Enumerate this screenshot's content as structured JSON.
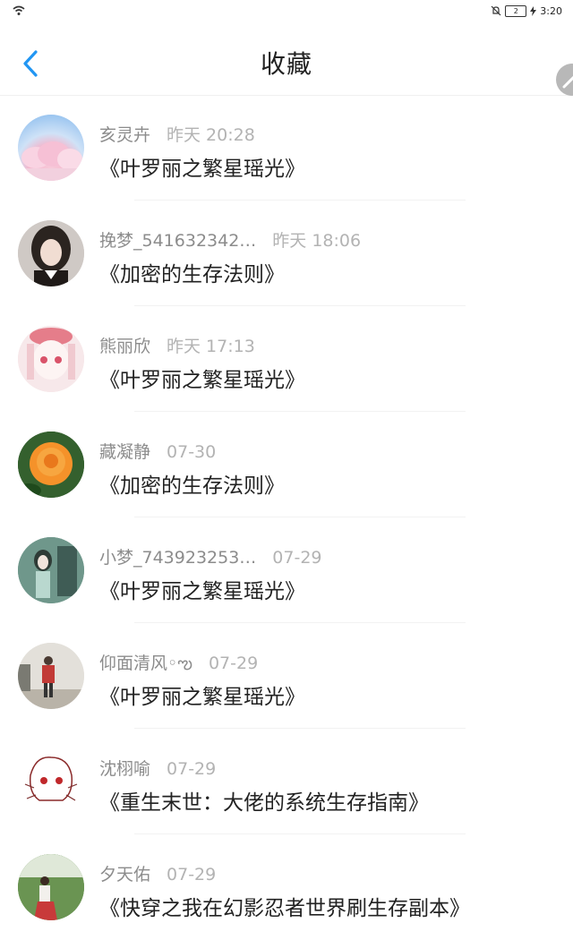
{
  "status": {
    "time": "3:20",
    "battery": "2"
  },
  "header": {
    "title": "收藏"
  },
  "colors": {
    "accent": "#2196f3",
    "name_text": "#8c8c8c",
    "time_text": "#b3b3b3"
  },
  "favorites": [
    {
      "user": "亥灵卉",
      "time": "昨天 20:28",
      "book": "《叶罗丽之繁星瑶光》",
      "avatar": "pink-snow-trees"
    },
    {
      "user": "挽梦_541632342…",
      "time": "昨天 18:06",
      "book": "《加密的生存法则》",
      "avatar": "girl-photo"
    },
    {
      "user": "熊丽欣",
      "time": "昨天 17:13",
      "book": "《叶罗丽之繁星瑶光》",
      "avatar": "anime-girl-pink"
    },
    {
      "user": "藏凝静",
      "time": "07-30",
      "book": "《加密的生存法则》",
      "avatar": "orange-rose"
    },
    {
      "user": "小梦_743923253…",
      "time": "07-29",
      "book": "《叶罗丽之繁星瑶光》",
      "avatar": "anime-girl-green"
    },
    {
      "user": "仰面清风◦ఌ",
      "time": "07-29",
      "book": "《叶罗丽之繁星瑶光》",
      "avatar": "person-red-outdoor"
    },
    {
      "user": "沈栩喻",
      "time": "07-29",
      "book": "《重生末世：大佬的系统生存指南》",
      "avatar": "anime-sketch"
    },
    {
      "user": "夕天佑",
      "time": "07-29",
      "book": "《快穿之我在幻影忍者世界刷生存副本》",
      "avatar": "person-outdoor-green"
    }
  ]
}
